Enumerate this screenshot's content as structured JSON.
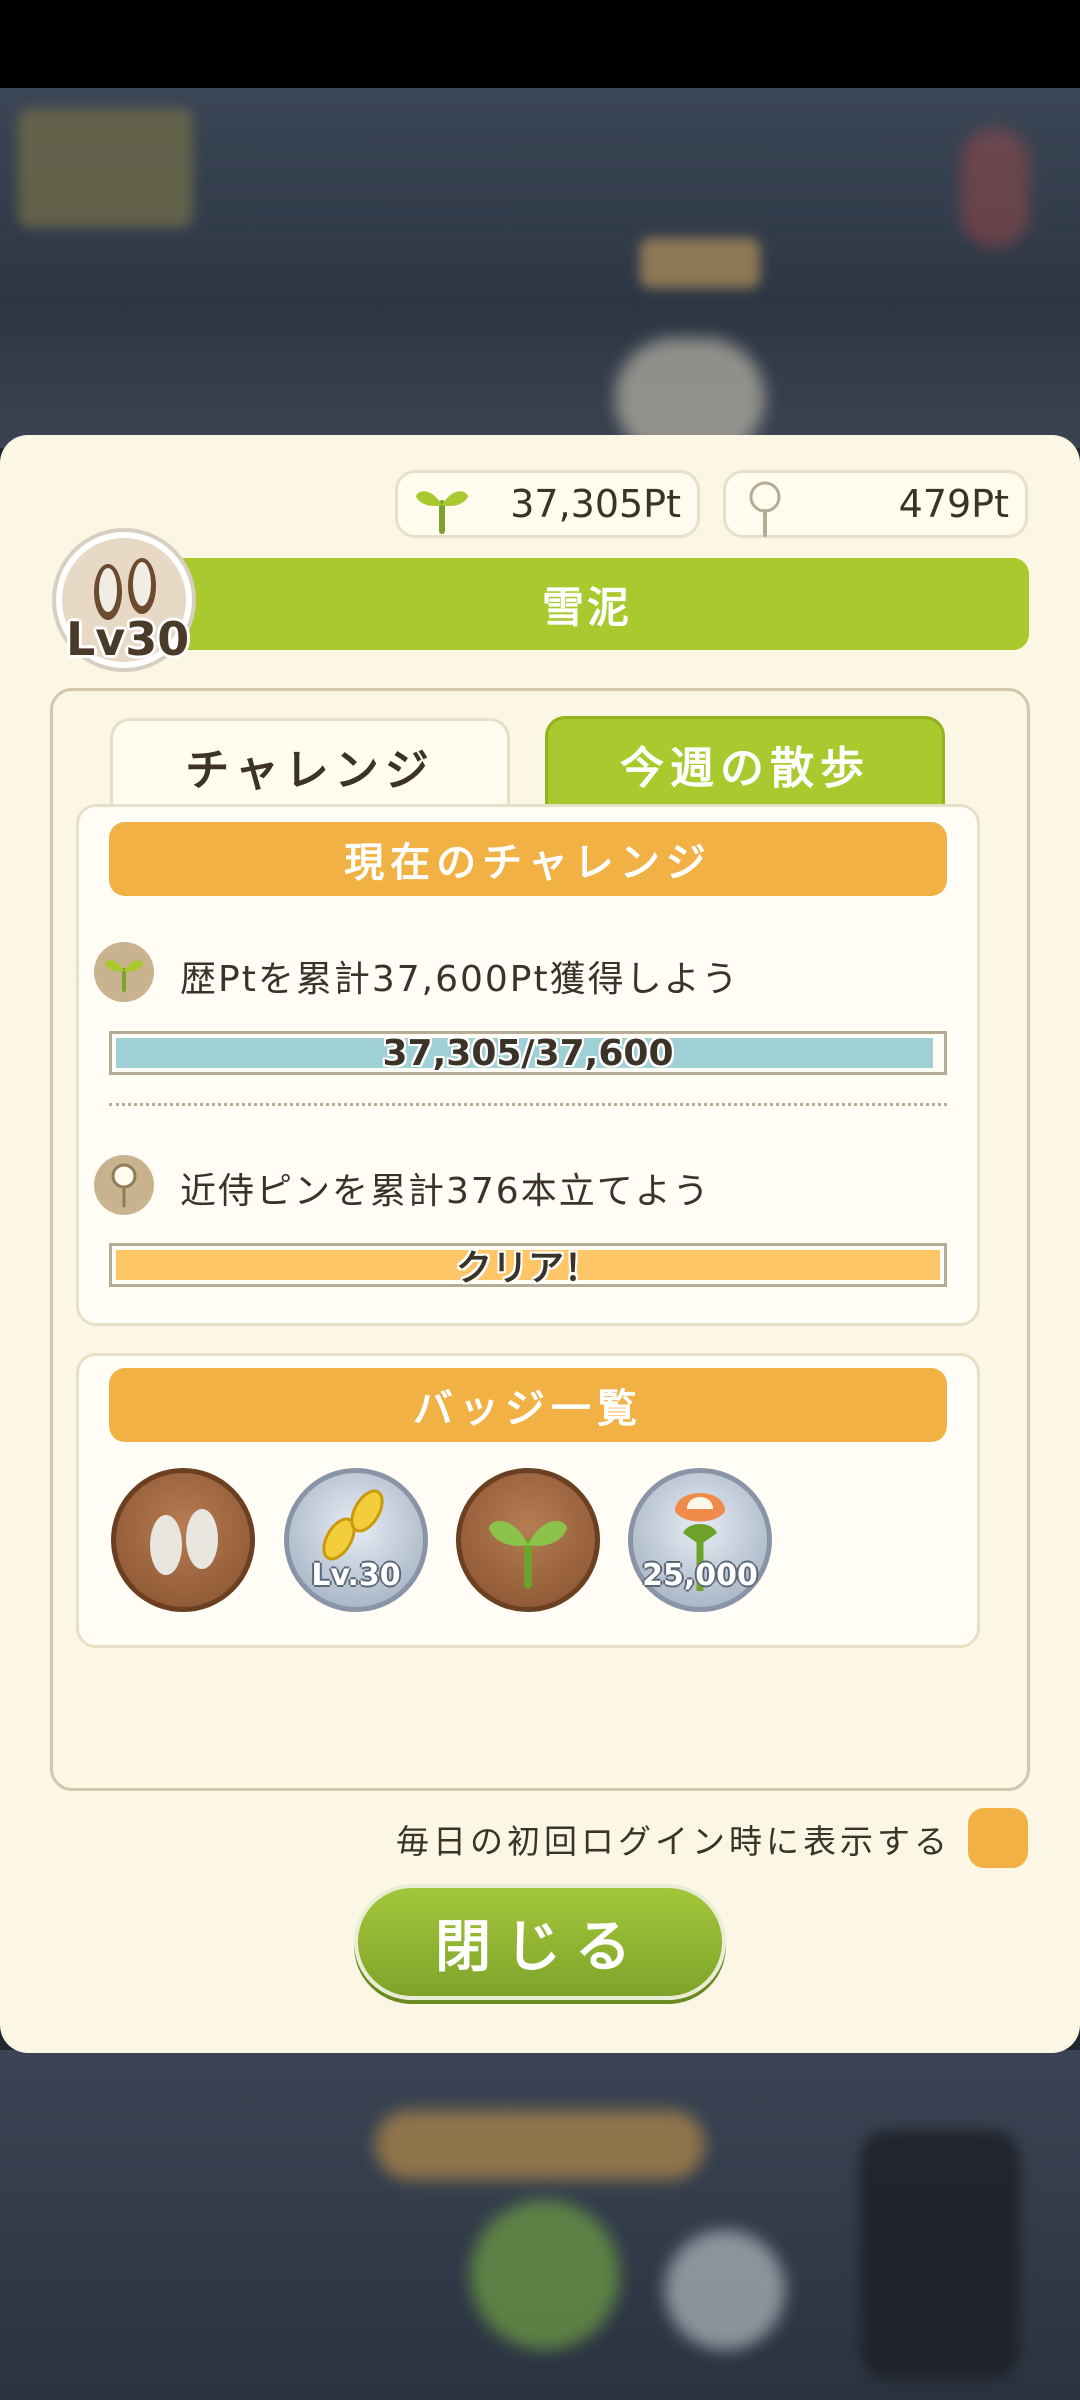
{
  "points": {
    "sprout_points": "37,305Pt",
    "pin_points": "479Pt"
  },
  "player": {
    "name": "雪泥",
    "level": "Lv30"
  },
  "tabs": {
    "challenge": "チャレンジ",
    "weekly_walk": "今週の散歩"
  },
  "current_challenge": {
    "header": "現在のチャレンジ",
    "items": [
      {
        "icon": "sprout-icon",
        "text": "歴Ptを累計37,600Pt獲得しよう",
        "progress_label": "37,305/37,600",
        "progress": 0.992
      },
      {
        "icon": "pin-icon",
        "text": "近侍ピンを累計376本立てよう",
        "progress_label": "クリア！",
        "progress": 1.0
      }
    ]
  },
  "badges": {
    "header": "バッジ一覧",
    "items": [
      {
        "icon": "footprints-badge-icon",
        "caption": ""
      },
      {
        "icon": "golden-footprints-badge-icon",
        "caption": "Lv.30"
      },
      {
        "icon": "sprout-badge-icon",
        "caption": ""
      },
      {
        "icon": "flower-badge-icon",
        "caption": "25,000"
      }
    ]
  },
  "daily_login": {
    "label": "毎日の初回ログイン時に表示する"
  },
  "close_button": {
    "label": "閉じる"
  },
  "colors": {
    "accent_green": "#a9c92e",
    "accent_orange": "#f2b144",
    "progress_blue": "#9fd0d6",
    "panel_bg": "#fcf6e4"
  }
}
